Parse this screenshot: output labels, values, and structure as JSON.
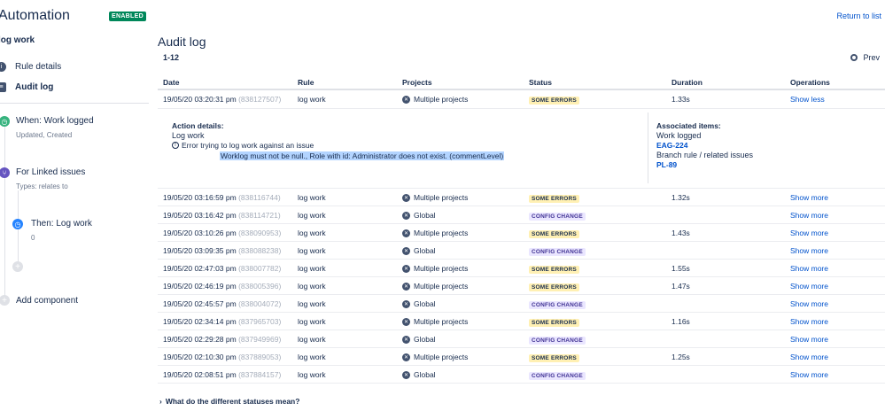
{
  "header": {
    "app_title": "Automation",
    "enabled_badge": "ENABLED",
    "return_link": "Return to list"
  },
  "sidebar": {
    "rule_name": "log work",
    "nav": [
      {
        "label": "Rule details",
        "icon": "info-icon"
      },
      {
        "label": "Audit log",
        "icon": "list-icon"
      }
    ],
    "components": [
      {
        "label": "When: Work logged",
        "sub": "Updated, Created",
        "icon": "clock-icon",
        "color": "#36b37e"
      },
      {
        "label": "For Linked issues",
        "sub": "Types: relates to",
        "icon": "branch-icon",
        "color": "#6554c0"
      },
      {
        "label": "Then: Log work",
        "sub": "0",
        "icon": "clock-icon",
        "color": "#2684ff"
      }
    ],
    "add_component": "Add component"
  },
  "main": {
    "title": "Audit log",
    "range": "1-12",
    "prev_label": "Prev",
    "columns": [
      "Date",
      "Rule",
      "Projects",
      "Status",
      "Duration",
      "Operations"
    ],
    "expanded": {
      "date": "19/05/20 03:20:31 pm",
      "id": "(838127507)",
      "rule": "log work",
      "project": "Multiple projects",
      "status": "SOME ERRORS",
      "duration": "1.33s",
      "operation": "Show less",
      "action_title": "Action details:",
      "action_name": "Log work",
      "error_text": "Error trying to log work against an issue",
      "error_detail": "Worklog must not be null., Role with id: Administrator does not exist. (commentLevel)",
      "assoc_title": "Associated items:",
      "assoc_1": "Work logged",
      "assoc_1_link": "EAG-224",
      "assoc_2": "Branch rule / related issues",
      "assoc_2_link": "PL-89"
    },
    "rows": [
      {
        "date": "19/05/20 03:16:59 pm",
        "id": "(838116744)",
        "rule": "log work",
        "project": "Multiple projects",
        "status": "SOME ERRORS",
        "duration": "1.32s",
        "op": "Show more"
      },
      {
        "date": "19/05/20 03:16:42 pm",
        "id": "(838114721)",
        "rule": "log work",
        "project": "Global",
        "status": "CONFIG CHANGE",
        "duration": "",
        "op": "Show more"
      },
      {
        "date": "19/05/20 03:10:26 pm",
        "id": "(838090953)",
        "rule": "log work",
        "project": "Multiple projects",
        "status": "SOME ERRORS",
        "duration": "1.43s",
        "op": "Show more"
      },
      {
        "date": "19/05/20 03:09:35 pm",
        "id": "(838088238)",
        "rule": "log work",
        "project": "Global",
        "status": "CONFIG CHANGE",
        "duration": "",
        "op": "Show more"
      },
      {
        "date": "19/05/20 02:47:03 pm",
        "id": "(838007782)",
        "rule": "log work",
        "project": "Multiple projects",
        "status": "SOME ERRORS",
        "duration": "1.55s",
        "op": "Show more"
      },
      {
        "date": "19/05/20 02:46:19 pm",
        "id": "(838005396)",
        "rule": "log work",
        "project": "Multiple projects",
        "status": "SOME ERRORS",
        "duration": "1.47s",
        "op": "Show more"
      },
      {
        "date": "19/05/20 02:45:57 pm",
        "id": "(838004072)",
        "rule": "log work",
        "project": "Global",
        "status": "CONFIG CHANGE",
        "duration": "",
        "op": "Show more"
      },
      {
        "date": "19/05/20 02:34:14 pm",
        "id": "(837965703)",
        "rule": "log work",
        "project": "Multiple projects",
        "status": "SOME ERRORS",
        "duration": "1.16s",
        "op": "Show more"
      },
      {
        "date": "19/05/20 02:29:28 pm",
        "id": "(837949969)",
        "rule": "log work",
        "project": "Global",
        "status": "CONFIG CHANGE",
        "duration": "",
        "op": "Show more"
      },
      {
        "date": "19/05/20 02:10:30 pm",
        "id": "(837889053)",
        "rule": "log work",
        "project": "Multiple projects",
        "status": "SOME ERRORS",
        "duration": "1.25s",
        "op": "Show more"
      },
      {
        "date": "19/05/20 02:08:51 pm",
        "id": "(837884157)",
        "rule": "log work",
        "project": "Global",
        "status": "CONFIG CHANGE",
        "duration": "",
        "op": "Show more"
      }
    ],
    "footer_link": "What do the different statuses mean?"
  }
}
